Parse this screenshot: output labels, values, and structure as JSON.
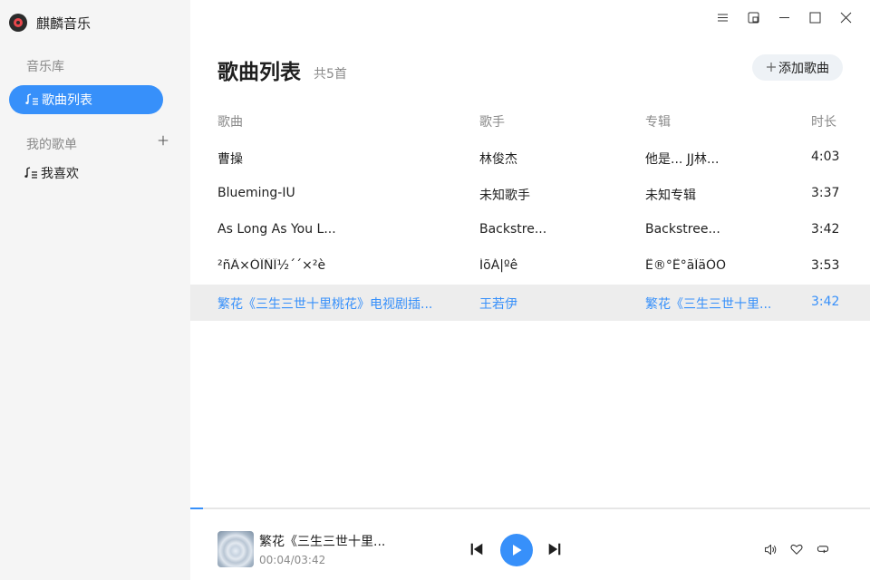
{
  "app": {
    "title": "麒麟音乐"
  },
  "sidebar": {
    "library_label": "音乐库",
    "active_item_label": "歌曲列表",
    "my_lists_label": "我的歌单",
    "favorites_label": "我喜欢"
  },
  "main": {
    "title": "歌曲列表",
    "count": "共5首",
    "add_song_label": "添加歌曲",
    "columns": {
      "title": "歌曲",
      "artist": "歌手",
      "album": "专辑",
      "duration": "时长"
    },
    "songs": [
      {
        "title": "曹操",
        "artist": "林俊杰",
        "album": "他是... JJ林...",
        "duration": "4:03"
      },
      {
        "title": "Blueming-IU",
        "artist": "未知歌手",
        "album": "未知专辑",
        "duration": "3:37"
      },
      {
        "title": "As Long As You L...",
        "artist": "Backstre...",
        "album": "Backstree...",
        "duration": "3:42"
      },
      {
        "title": "²ñÃ×ÓÎÑÎ½´´×²è",
        "artist": "ÍõÁ|ºê",
        "album": "Ê®°Ë°ãÎäÒÕ",
        "duration": "3:53"
      },
      {
        "title": "繁花《三生三世十里桃花》电视剧插...",
        "artist": "王若伊",
        "album": "繁花《三生三世十里...",
        "duration": "3:42"
      }
    ]
  },
  "player": {
    "now_playing_title": "繁花《三生三世十里...",
    "time_display": "00:04/03:42",
    "progress_fraction": 0.018
  },
  "colors": {
    "accent": "#3790fa",
    "sidebar_bg": "#f5f5f5",
    "active_row_bg": "#ededed"
  },
  "icons": {
    "window": [
      "menu-icon",
      "mini-mode-icon",
      "minimize-icon",
      "maximize-icon",
      "close-icon"
    ],
    "player": [
      "previous-icon",
      "play-icon",
      "next-icon",
      "volume-icon",
      "heart-icon",
      "loop-icon"
    ]
  }
}
